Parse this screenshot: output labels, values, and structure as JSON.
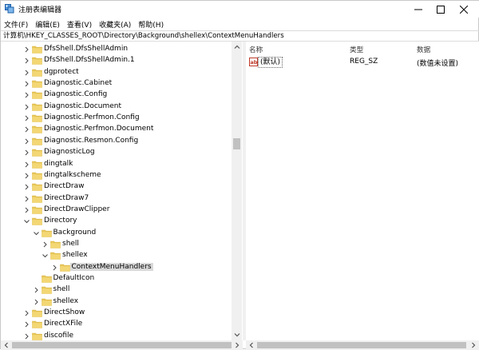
{
  "window": {
    "title": "注册表编辑器",
    "controls": {
      "minimize": "minimize-icon",
      "maximize": "maximize-icon",
      "close": "close-icon"
    }
  },
  "menu": [
    "文件(F)",
    "编辑(E)",
    "查看(V)",
    "收藏夹(A)",
    "帮助(H)"
  ],
  "address": "计算机\\HKEY_CLASSES_ROOT\\Directory\\Background\\shellex\\ContextMenuHandlers",
  "tree": {
    "items": [
      {
        "label": "DfsShell.DfsShellAdmin",
        "level": 0,
        "expander": "collapsed"
      },
      {
        "label": "DfsShell.DfsShellAdmin.1",
        "level": 0,
        "expander": "collapsed"
      },
      {
        "label": "dgprotect",
        "level": 0,
        "expander": "collapsed"
      },
      {
        "label": "Diagnostic.Cabinet",
        "level": 0,
        "expander": "collapsed"
      },
      {
        "label": "Diagnostic.Config",
        "level": 0,
        "expander": "collapsed"
      },
      {
        "label": "Diagnostic.Document",
        "level": 0,
        "expander": "collapsed"
      },
      {
        "label": "Diagnostic.Perfmon.Config",
        "level": 0,
        "expander": "collapsed"
      },
      {
        "label": "Diagnostic.Perfmon.Document",
        "level": 0,
        "expander": "collapsed"
      },
      {
        "label": "Diagnostic.Resmon.Config",
        "level": 0,
        "expander": "collapsed"
      },
      {
        "label": "DiagnosticLog",
        "level": 0,
        "expander": "collapsed"
      },
      {
        "label": "dingtalk",
        "level": 0,
        "expander": "collapsed"
      },
      {
        "label": "dingtalkscheme",
        "level": 0,
        "expander": "collapsed"
      },
      {
        "label": "DirectDraw",
        "level": 0,
        "expander": "collapsed"
      },
      {
        "label": "DirectDraw7",
        "level": 0,
        "expander": "collapsed"
      },
      {
        "label": "DirectDrawClipper",
        "level": 0,
        "expander": "collapsed"
      },
      {
        "label": "Directory",
        "level": 0,
        "expander": "expanded"
      },
      {
        "label": "Background",
        "level": 1,
        "expander": "expanded"
      },
      {
        "label": "shell",
        "level": 2,
        "expander": "collapsed"
      },
      {
        "label": "shellex",
        "level": 2,
        "expander": "expanded"
      },
      {
        "label": "ContextMenuHandlers",
        "level": 3,
        "expander": "collapsed",
        "selected": true
      },
      {
        "label": "DefaultIcon",
        "level": 1,
        "expander": "none"
      },
      {
        "label": "shell",
        "level": 1,
        "expander": "collapsed"
      },
      {
        "label": "shellex",
        "level": 1,
        "expander": "collapsed"
      },
      {
        "label": "DirectShow",
        "level": 0,
        "expander": "collapsed"
      },
      {
        "label": "DirectXFile",
        "level": 0,
        "expander": "collapsed"
      },
      {
        "label": "discofile",
        "level": 0,
        "expander": "collapsed"
      }
    ]
  },
  "list": {
    "headers": {
      "name": "名称",
      "type": "类型",
      "data": "数据"
    },
    "values": [
      {
        "icon": "string-value-icon",
        "name": "(默认)",
        "type": "REG_SZ",
        "data": "(数值未设置)"
      }
    ]
  },
  "colors": {
    "folder": "#e8c85a",
    "folder_shade": "#d9b23c",
    "selection": "#d9d9d9",
    "value_icon": "#c0392b"
  }
}
